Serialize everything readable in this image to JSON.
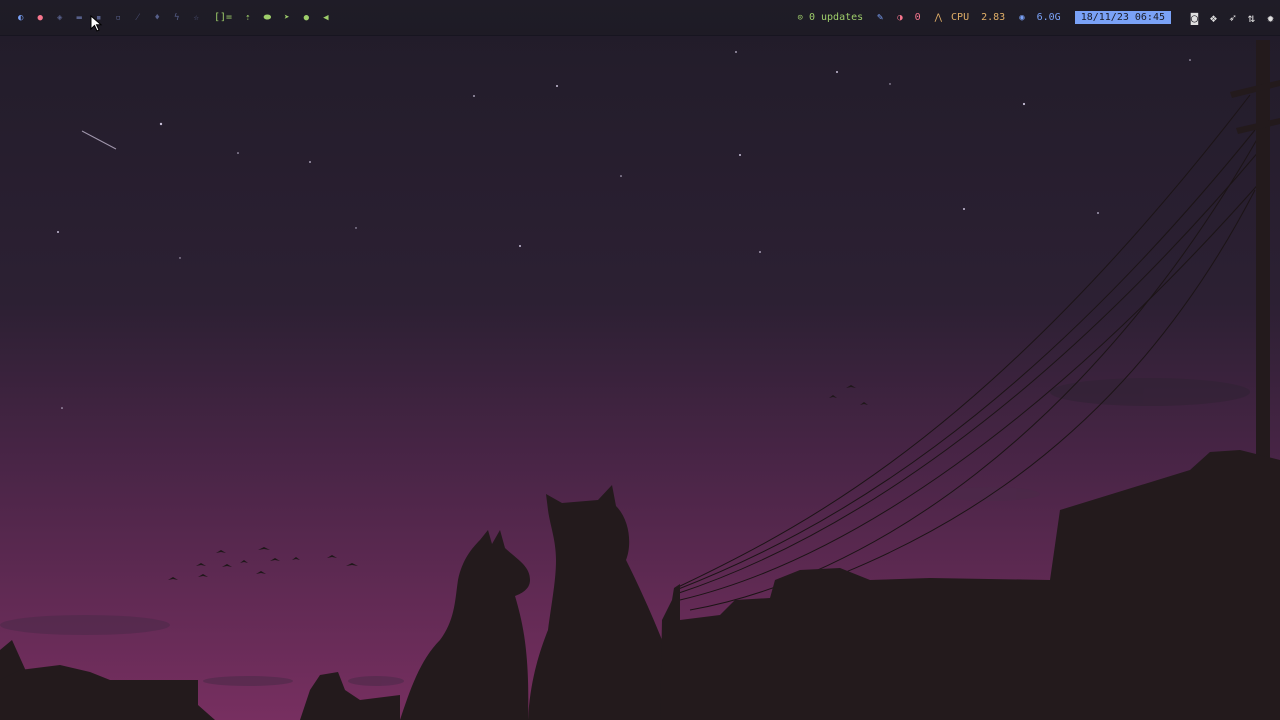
{
  "topbar": {
    "workspaces": [
      {
        "icon": "arch-logo-icon",
        "glyph": "◐",
        "color": "#7aa2f7"
      },
      {
        "icon": "record-icon",
        "glyph": "●",
        "color": "#f7768e"
      },
      {
        "icon": "shield-icon",
        "glyph": "◈",
        "color": "#565f89"
      },
      {
        "icon": "mail-icon",
        "glyph": "▬",
        "color": "#565f89"
      },
      {
        "icon": "terminal-icon",
        "glyph": "▪",
        "color": "#565f89"
      },
      {
        "icon": "trash-icon",
        "glyph": "▫",
        "color": "#565f89"
      },
      {
        "icon": "pen-icon",
        "glyph": "⁄",
        "color": "#565f89"
      },
      {
        "icon": "drop-icon",
        "glyph": "♦",
        "color": "#565f89"
      },
      {
        "icon": "bolt-icon",
        "glyph": "ϟ",
        "color": "#565f89"
      },
      {
        "icon": "star-icon",
        "glyph": "☆",
        "color": "#565f89"
      }
    ],
    "layout_label": "[]=",
    "tray_left_icons": [
      {
        "icon": "upload-icon",
        "glyph": "⇡",
        "color": "#9ece6a"
      },
      {
        "icon": "shield-check-icon",
        "glyph": "⬬",
        "color": "#9ece6a"
      },
      {
        "icon": "send-icon",
        "glyph": "➤",
        "color": "#9ece6a"
      },
      {
        "icon": "globe-icon",
        "glyph": "●",
        "color": "#9ece6a"
      },
      {
        "icon": "volume-icon",
        "glyph": "◀",
        "color": "#9ece6a"
      }
    ],
    "updates": {
      "icon": "package-icon",
      "text": "0 updates",
      "color": "#9ece6a"
    },
    "pin": {
      "icon": "pin-icon",
      "color": "#7aa2f7"
    },
    "notifications": {
      "icon": "notification-icon",
      "text": "0",
      "color": "#f7768e"
    },
    "cpu": {
      "icon": "cpu-icon",
      "label": "CPU",
      "value": "2.83",
      "color": "#e0af68"
    },
    "memory": {
      "icon": "memory-icon",
      "value": "6.0G",
      "color": "#7aa2f7"
    },
    "clock": {
      "text": "18/11/23 06:45",
      "bg": "#7aa2f7"
    },
    "tray_right_icons": [
      {
        "icon": "camera-icon",
        "glyph": "◙"
      },
      {
        "icon": "dropbox-icon",
        "glyph": "❖"
      },
      {
        "icon": "feather-icon",
        "glyph": "➶"
      },
      {
        "icon": "transfer-icon",
        "glyph": "⇅"
      },
      {
        "icon": "settings-gear-icon",
        "glyph": "✹"
      }
    ]
  },
  "wallpaper": {
    "sky_top": "#221d2a",
    "sky_mid": "#3a2340",
    "sky_bottom": "#6f2f5c",
    "silhouette": "#231a1c"
  }
}
